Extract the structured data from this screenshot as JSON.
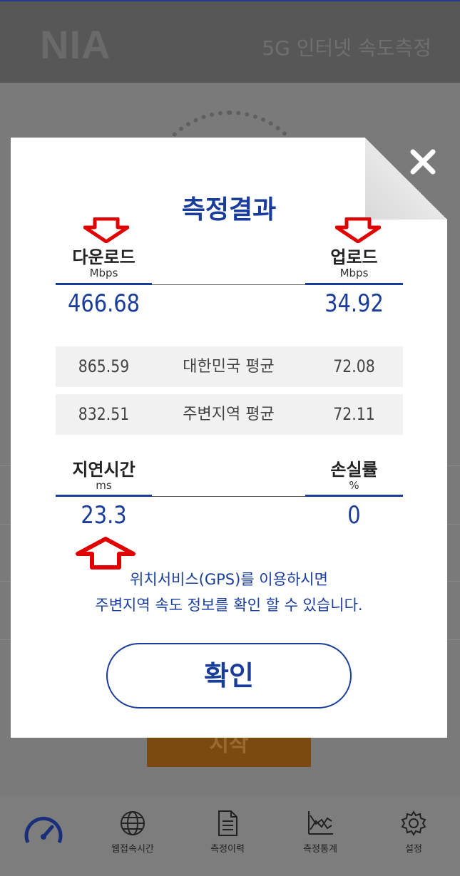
{
  "header": {
    "logo": "NIA",
    "title": "5G 인터넷 속도측정"
  },
  "background": {
    "start_label": "시작"
  },
  "bottom_nav": {
    "items": [
      {
        "label": "",
        "icon": "speedometer-icon"
      },
      {
        "label": "웹접속시간",
        "icon": "globe-icon"
      },
      {
        "label": "측정이력",
        "icon": "document-icon"
      },
      {
        "label": "측정통계",
        "icon": "chart-icon"
      },
      {
        "label": "설정",
        "icon": "gear-icon"
      }
    ]
  },
  "modal": {
    "title": "측정결과",
    "download": {
      "label": "다운로드",
      "unit": "Mbps",
      "value": "466.68"
    },
    "upload": {
      "label": "업로드",
      "unit": "Mbps",
      "value": "34.92"
    },
    "national_avg": {
      "label": "대한민국 평균",
      "download": "865.59",
      "upload": "72.08"
    },
    "nearby_avg": {
      "label": "주변지역 평균",
      "download": "832.51",
      "upload": "72.11"
    },
    "latency": {
      "label": "지연시간",
      "unit": "ms",
      "value": "23.3"
    },
    "loss": {
      "label": "손실률",
      "unit": "%",
      "value": "0"
    },
    "notice_line1": "위치서비스(GPS)를 이용하시면",
    "notice_line2": "주변지역 속도 정보를 확인 할 수 있습니다.",
    "confirm_label": "확인"
  },
  "colors": {
    "accent": "#1a3d9c",
    "annotation": "#e00000"
  }
}
